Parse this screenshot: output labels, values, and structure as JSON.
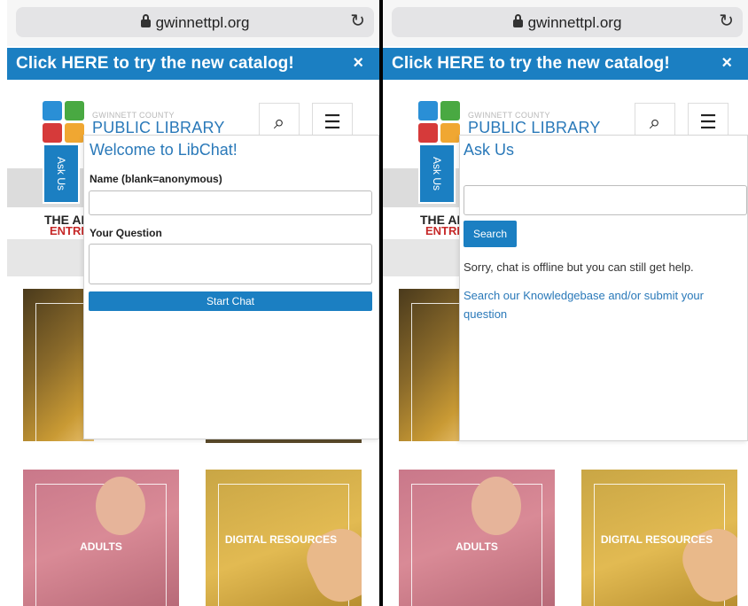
{
  "browser": {
    "url": "gwinnettpl.org"
  },
  "banner": {
    "text": "Click HERE to try the new catalog!",
    "close": "×"
  },
  "library": {
    "county": "GWINNETT COUNTY",
    "name": "PUBLIC LIBRARY"
  },
  "header": {
    "search_icon": "⌕",
    "menu_icon": "☰"
  },
  "ask_tab": {
    "label": "Ask Us"
  },
  "hero": {
    "line1": "THE AMA",
    "line2": "ENTRE"
  },
  "tiles": {
    "adults": "ADULTS",
    "digital": "DIGITAL RESOURCES"
  },
  "left_widget": {
    "title": "Welcome to LibChat!",
    "name_label": "Name (blank=anonymous)",
    "name_value": "",
    "question_label": "Your Question",
    "question_value": "",
    "start_button": "Start Chat"
  },
  "right_widget": {
    "title": "Ask Us",
    "search_value": "",
    "search_button": "Search",
    "offline_msg": "Sorry, chat is offline but you can still get help.",
    "kb_link": "Search our Knowledgebase and/or submit your question"
  },
  "colors": {
    "brand_blue": "#1b7fc2",
    "link_blue": "#2a79b9",
    "hero_red": "#c62828"
  },
  "icons": [
    "lock-icon",
    "reload-icon",
    "close-icon",
    "search-icon",
    "menu-icon",
    "logo-icon"
  ]
}
